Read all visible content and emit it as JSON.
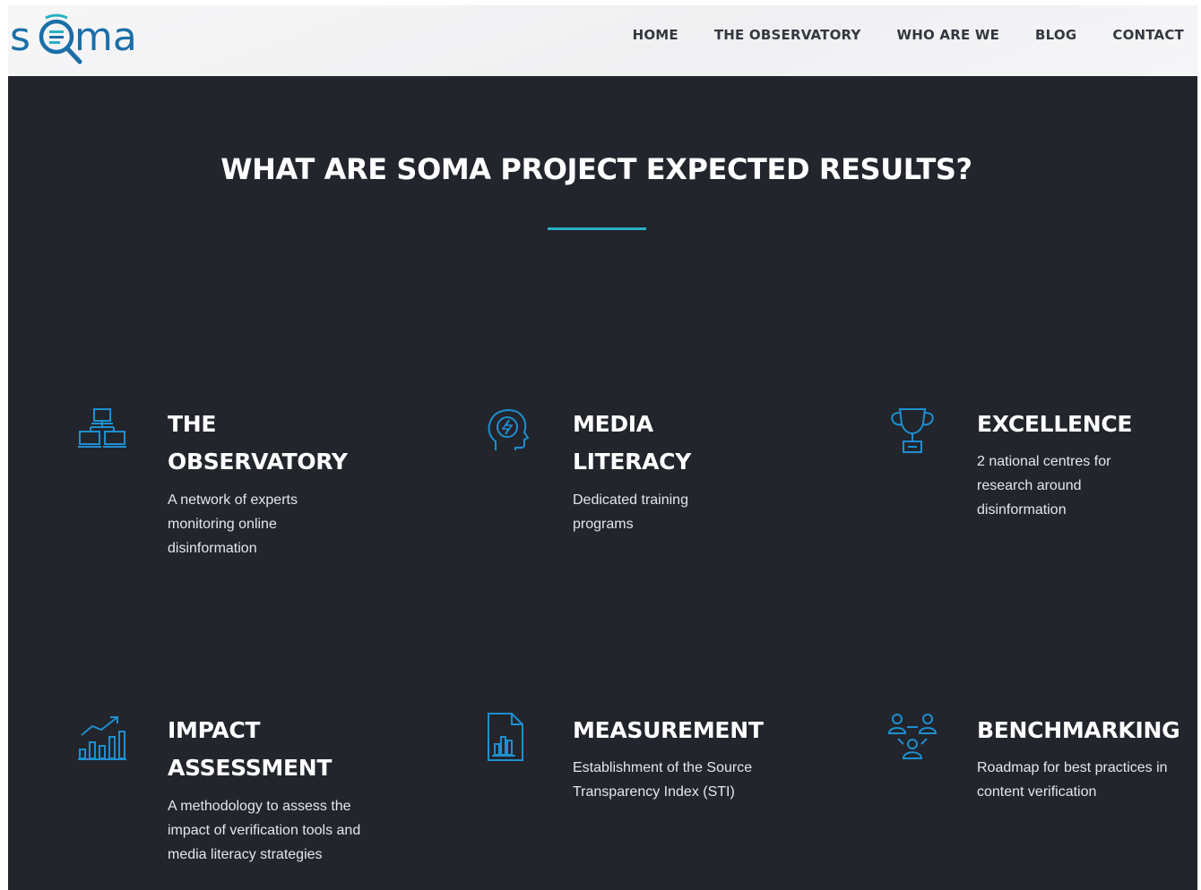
{
  "brand": {
    "logo_text": "soma"
  },
  "nav": {
    "items": [
      {
        "label": "HOME"
      },
      {
        "label": "THE OBSERVATORY"
      },
      {
        "label": "WHO ARE WE"
      },
      {
        "label": "BLOG"
      },
      {
        "label": "CONTACT"
      }
    ]
  },
  "section": {
    "title": "WHAT ARE SOMA PROJECT EXPECTED RESULTS?",
    "accent_color": "#27b1c3",
    "icon_color": "#1f8fcf",
    "background": "#22252c"
  },
  "cards": [
    {
      "icon": "network-icon",
      "title_line1": "THE",
      "title_line2": "OBSERVATORY",
      "description": "A network of experts monitoring online disinformation"
    },
    {
      "icon": "brain-head-icon",
      "title_line1": "MEDIA",
      "title_line2": "LITERACY",
      "description": "Dedicated training programs"
    },
    {
      "icon": "trophy-icon",
      "title_line1": "EXCELLENCE",
      "description": "2 national centres for research around disinformation"
    },
    {
      "icon": "chart-growth-icon",
      "title_line1": "IMPACT",
      "title_line2": "ASSESSMENT",
      "description": "A methodology to assess the impact of verification tools and media literacy strategies"
    },
    {
      "icon": "document-chart-icon",
      "title_line1": "MEASUREMENT",
      "description": "Establishment of the Source Transparency Index (STI)"
    },
    {
      "icon": "people-group-icon",
      "title_line1": "BENCHMARKING",
      "description": "Roadmap for best practices in content verification"
    }
  ]
}
